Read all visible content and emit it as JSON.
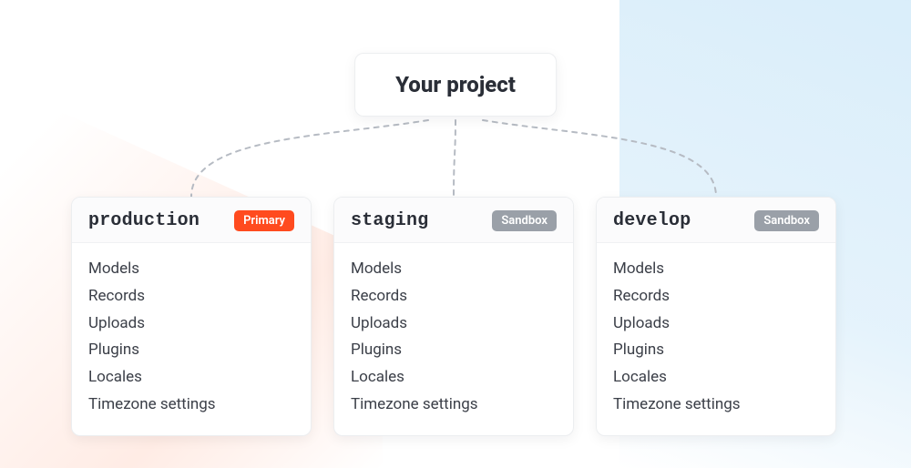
{
  "project": {
    "title": "Your project"
  },
  "badges": {
    "primary": "Primary",
    "sandbox": "Sandbox"
  },
  "environments": [
    {
      "name": "production",
      "badge_type": "primary",
      "items": [
        "Models",
        "Records",
        "Uploads",
        "Plugins",
        "Locales",
        "Timezone settings"
      ]
    },
    {
      "name": "staging",
      "badge_type": "sandbox",
      "items": [
        "Models",
        "Records",
        "Uploads",
        "Plugins",
        "Locales",
        "Timezone settings"
      ]
    },
    {
      "name": "develop",
      "badge_type": "sandbox",
      "items": [
        "Models",
        "Records",
        "Uploads",
        "Plugins",
        "Locales",
        "Timezone settings"
      ]
    }
  ]
}
